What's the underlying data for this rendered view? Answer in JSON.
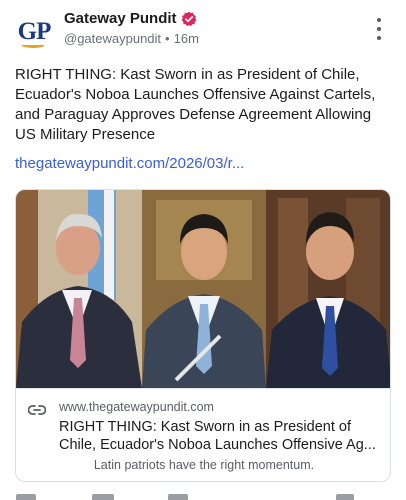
{
  "post": {
    "author_name": "Gateway Pundit",
    "avatar_initials": "GP",
    "handle": "@gatewaypundit",
    "separator": "•",
    "time": "16m",
    "text": "RIGHT THING: Kast Sworn in as President of Chile, Ecuador's Noboa Launches Offensive Against Cartels, and Paraguay Approves Defense Agreement Allowing US Military Presence",
    "link_text": "thegatewaypundit.com/2026/03/r..."
  },
  "card": {
    "domain": "www.thegatewaypundit.com",
    "title": "RIGHT THING: Kast Sworn in as President of Chile, Ecuador's Noboa Launches Offensive Ag...",
    "description": "Latin patriots have the right momentum."
  },
  "colors": {
    "link": "#3a5fcf",
    "verified_badge": "#e0245e",
    "brand_blue": "#1d3a7a",
    "brand_gold": "#e8a21b"
  },
  "icons": [
    "verified-badge-icon",
    "more-options-icon",
    "link-icon"
  ]
}
